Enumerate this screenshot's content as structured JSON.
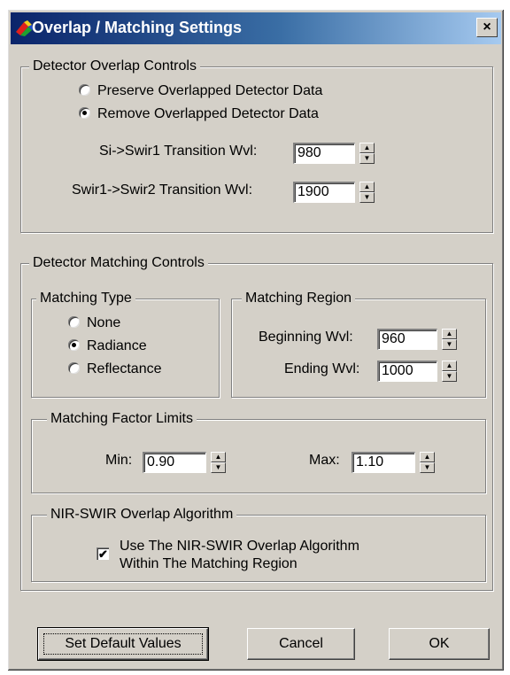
{
  "window": {
    "title": "Overlap / Matching Settings",
    "close_label": "×"
  },
  "overlap": {
    "legend": "Detector Overlap Controls",
    "preserve_label": "Preserve Overlapped Detector Data",
    "remove_label": "Remove Overlapped Detector Data",
    "selected": "remove",
    "si_swir1_label": "Si->Swir1 Transition Wvl:",
    "si_swir1_value": "980",
    "swir1_swir2_label": "Swir1->Swir2 Transition Wvl:",
    "swir1_swir2_value": "1900"
  },
  "matching": {
    "legend": "Detector Matching Controls",
    "type": {
      "legend": "Matching Type",
      "none_label": "None",
      "radiance_label": "Radiance",
      "reflectance_label": "Reflectance",
      "selected": "radiance"
    },
    "region": {
      "legend": "Matching Region",
      "beginning_label": "Beginning Wvl:",
      "beginning_value": "960",
      "ending_label": "Ending Wvl:",
      "ending_value": "1000"
    },
    "factor": {
      "legend": "Matching Factor Limits",
      "min_label": "Min:",
      "min_value": "0.90",
      "max_label": "Max:",
      "max_value": "1.10"
    },
    "nir_swir": {
      "legend": "NIR-SWIR Overlap Algorithm",
      "checkbox_line1": "Use The NIR-SWIR Overlap Algorithm",
      "checkbox_line2": "Within The Matching Region",
      "checked": true
    }
  },
  "buttons": {
    "defaults_label": "Set Default Values",
    "cancel_label": "Cancel",
    "ok_label": "OK"
  },
  "icons": {
    "spin_up": "▲",
    "spin_down": "▼",
    "check": "✔"
  }
}
